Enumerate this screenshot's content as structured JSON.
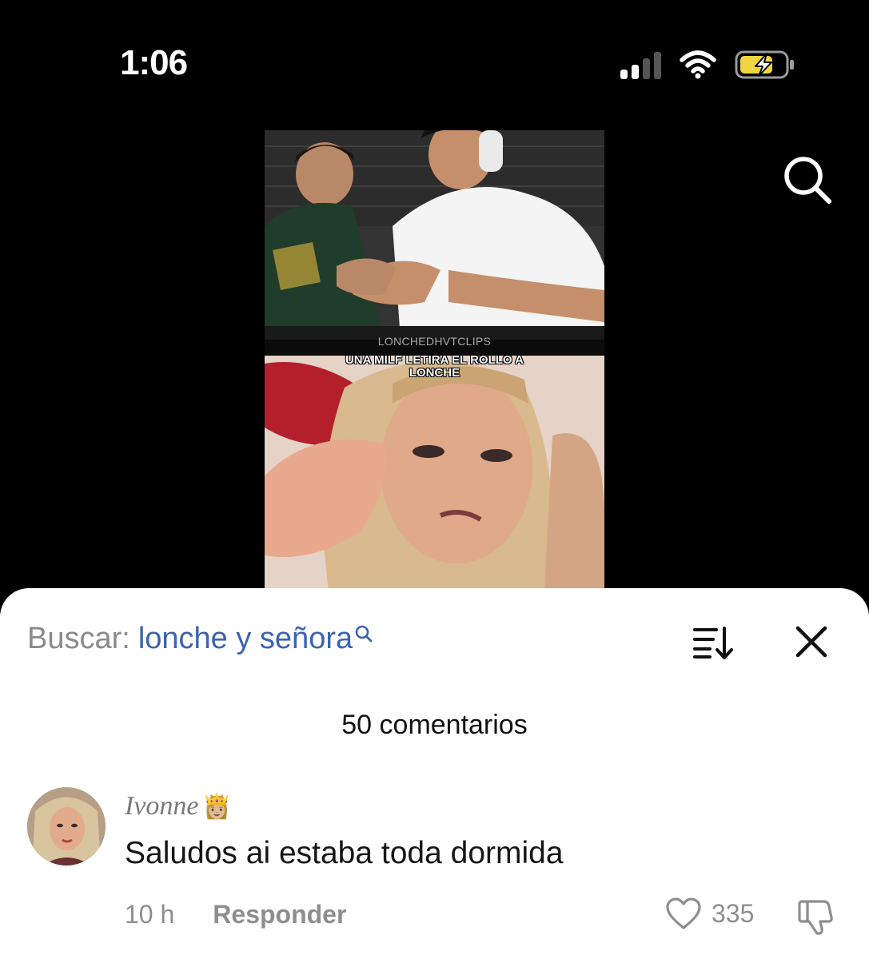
{
  "status_bar": {
    "time": "1:06",
    "signal_icon": "cellular-signal-icon",
    "wifi_icon": "wifi-icon",
    "battery_icon": "battery-charging-icon",
    "battery_color": "#f0d543"
  },
  "video": {
    "watermark": "LONCHEDHVTCLIPS",
    "caption": "UNA MILF LETIRA EL ROLLO A\nLONCHE",
    "search_icon": "search-icon"
  },
  "comments_sheet": {
    "search_label": "Buscar:",
    "search_query": "lonche y señora",
    "search_query_color": "#3a64b0",
    "sort_icon": "sort-icon",
    "close_icon": "close-icon",
    "comment_count": "50 comentarios",
    "comments": [
      {
        "username": "Ivonne",
        "badge": "👸🏼",
        "text": "Saludos ai estaba toda dormida",
        "time": "10 h",
        "reply_label": "Responder",
        "likes": "335",
        "like_icon": "heart-icon",
        "dislike_icon": "thumbs-down-icon"
      }
    ]
  }
}
